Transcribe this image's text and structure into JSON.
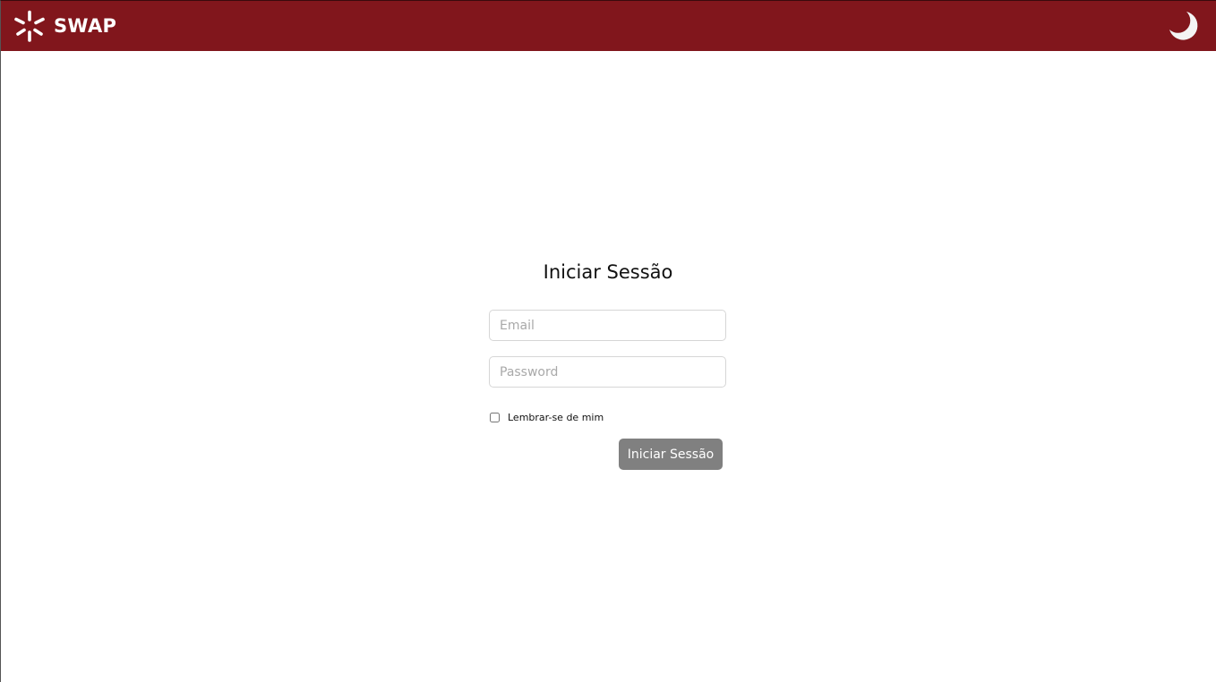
{
  "header": {
    "brand": {
      "name": "SWAP",
      "icon": "swap-logo-icon"
    },
    "theme_toggle": {
      "icon": "moon-icon"
    },
    "colors": {
      "header_bg": "#81161c",
      "header_text": "#ffffff"
    }
  },
  "login": {
    "title": "Iniciar Sessão",
    "email": {
      "value": "",
      "placeholder": "Email"
    },
    "password": {
      "value": "",
      "placeholder": "Password"
    },
    "remember_me": {
      "label": "Lembrar-se de mim",
      "checked": false
    },
    "submit_label": "Iniciar Sessão",
    "colors": {
      "submit_bg": "#808080",
      "input_border": "#d6d6d6"
    }
  }
}
